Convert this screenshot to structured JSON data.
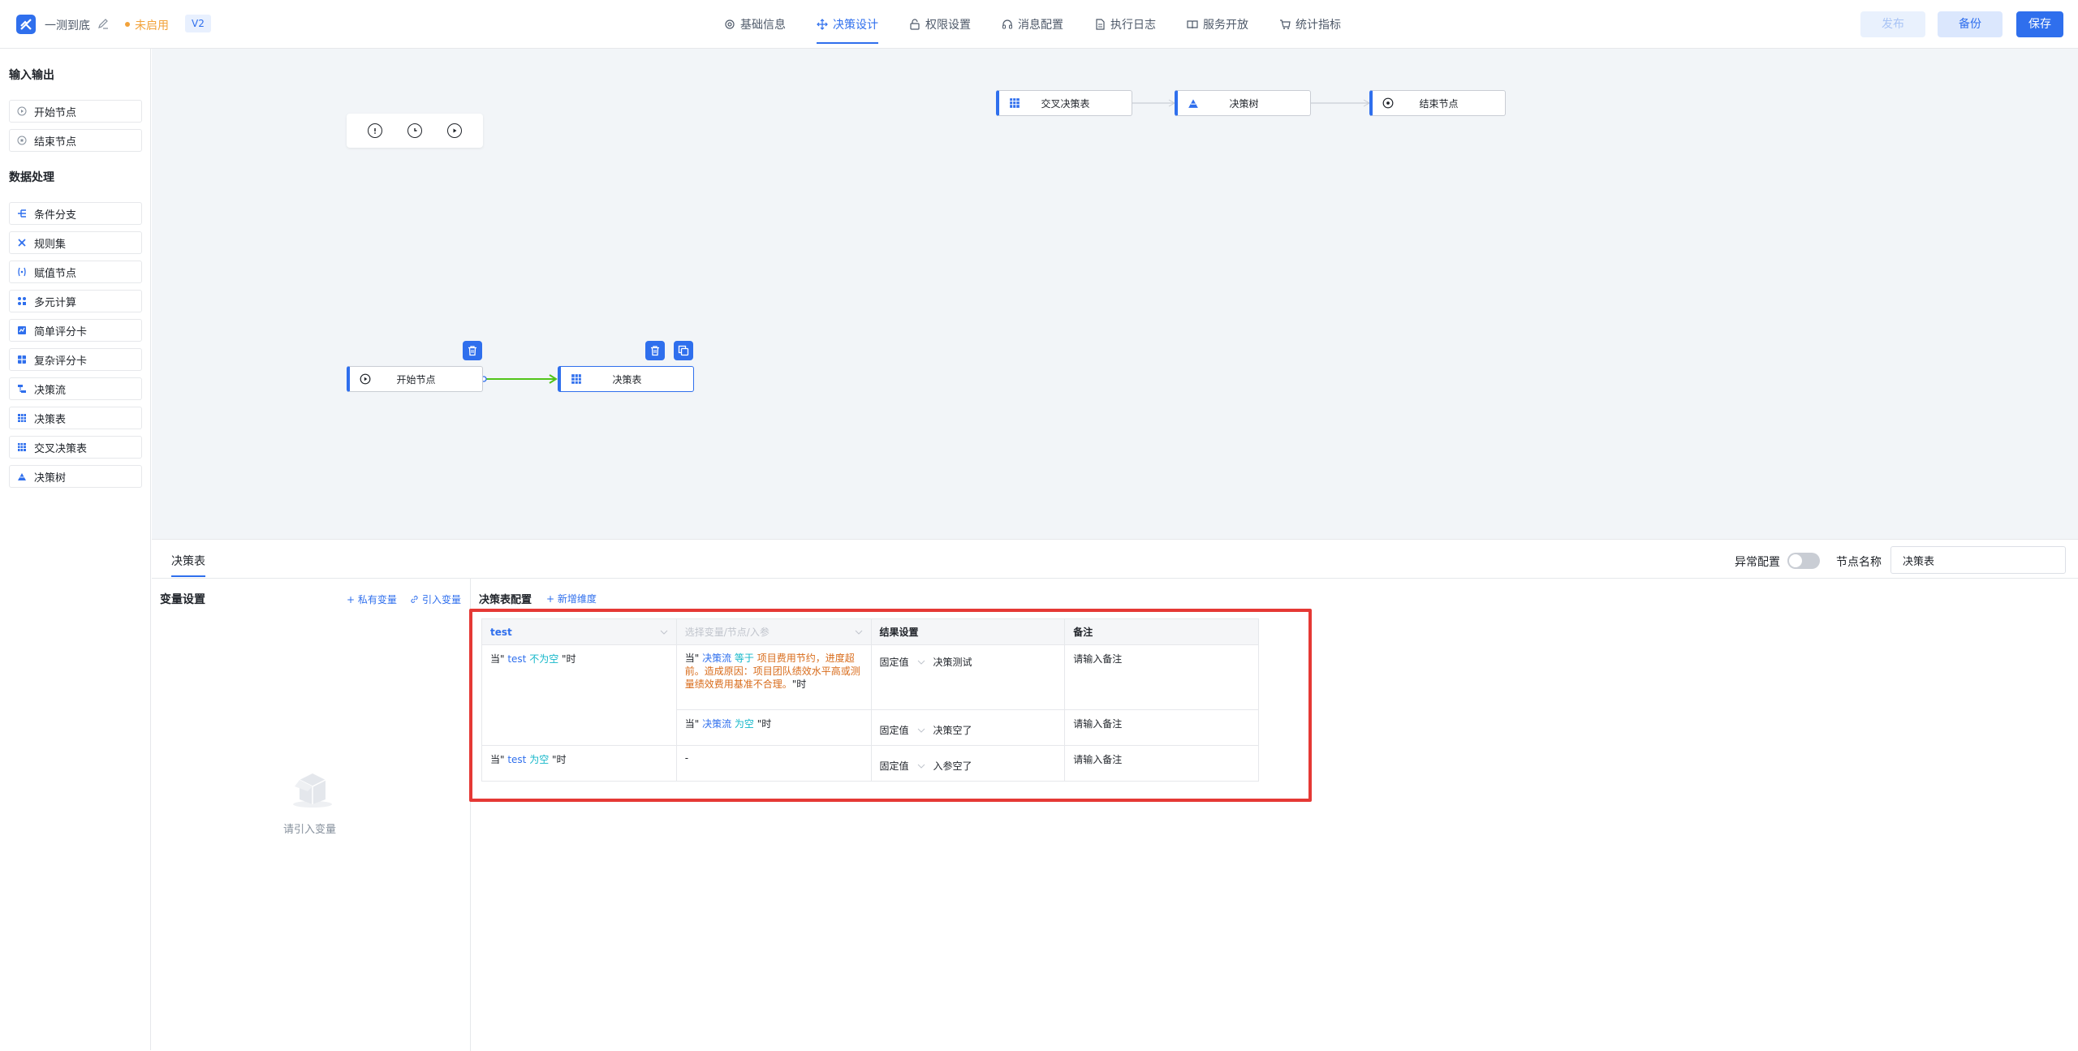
{
  "header": {
    "app_title": "一测到底",
    "status": "未启用",
    "version": "V2",
    "tabs": [
      "基础信息",
      "决策设计",
      "权限设置",
      "消息配置",
      "执行日志",
      "服务开放",
      "统计指标"
    ],
    "active_tab": "决策设计",
    "publish_label": "发布",
    "backup_label": "备份",
    "save_label": "保存"
  },
  "sidebar": {
    "section_io": "输入输出",
    "io_items": [
      "开始节点",
      "结束节点"
    ],
    "section_data": "数据处理",
    "data_items": [
      "条件分支",
      "规则集",
      "赋值节点",
      "多元计算",
      "简单评分卡",
      "复杂评分卡",
      "决策流",
      "决策表",
      "交叉决策表",
      "决策树"
    ]
  },
  "canvas": {
    "nodes": {
      "cross_table": "交叉决策表",
      "tree": "决策树",
      "end": "结束节点",
      "start": "开始节点",
      "table": "决策表"
    }
  },
  "panel": {
    "tab": "决策表",
    "exception_label": "异常配置",
    "node_name_label": "节点名称",
    "node_name_value": "决策表",
    "var_title": "变量设置",
    "add_private_var": "+ 私有变量",
    "import_var": "引入变量",
    "empty_text": "请引入变量",
    "config_title": "决策表配置",
    "add_dimension": "+ 新增维度",
    "table": {
      "col1": "test",
      "col2_placeholder": "选择变量/节点/入参",
      "col3": "结果设置",
      "col4": "备注",
      "r1c1_a": "当\" ",
      "r1c1_var": "test",
      "r1c1_op": " 不为空 ",
      "r1c1_b": "\"时",
      "r1_cond_pre": "当\" ",
      "r1_cond_var": "决策流",
      "r1_cond_op": " 等于 ",
      "r1_cond_text": "项目费用节约，进度超前。造成原因：项目团队绩效水平高或测量绩效费用基准不合理。",
      "r1_cond_post": "\"时",
      "r2_cond_pre": "当\" ",
      "r2_cond_var": "决策流",
      "r2_cond_op": " 为空 ",
      "r2_cond_post": "\"时",
      "r3c1_a": "当\" ",
      "r3c1_var": "test",
      "r3c1_op": " 为空 ",
      "r3c1_b": "\"时",
      "r3_cond": "-",
      "fixed": "固定值",
      "result1": "决策测试",
      "result2": "决策空了",
      "result3": "入参空了",
      "note_placeholder": "请输入备注"
    }
  }
}
